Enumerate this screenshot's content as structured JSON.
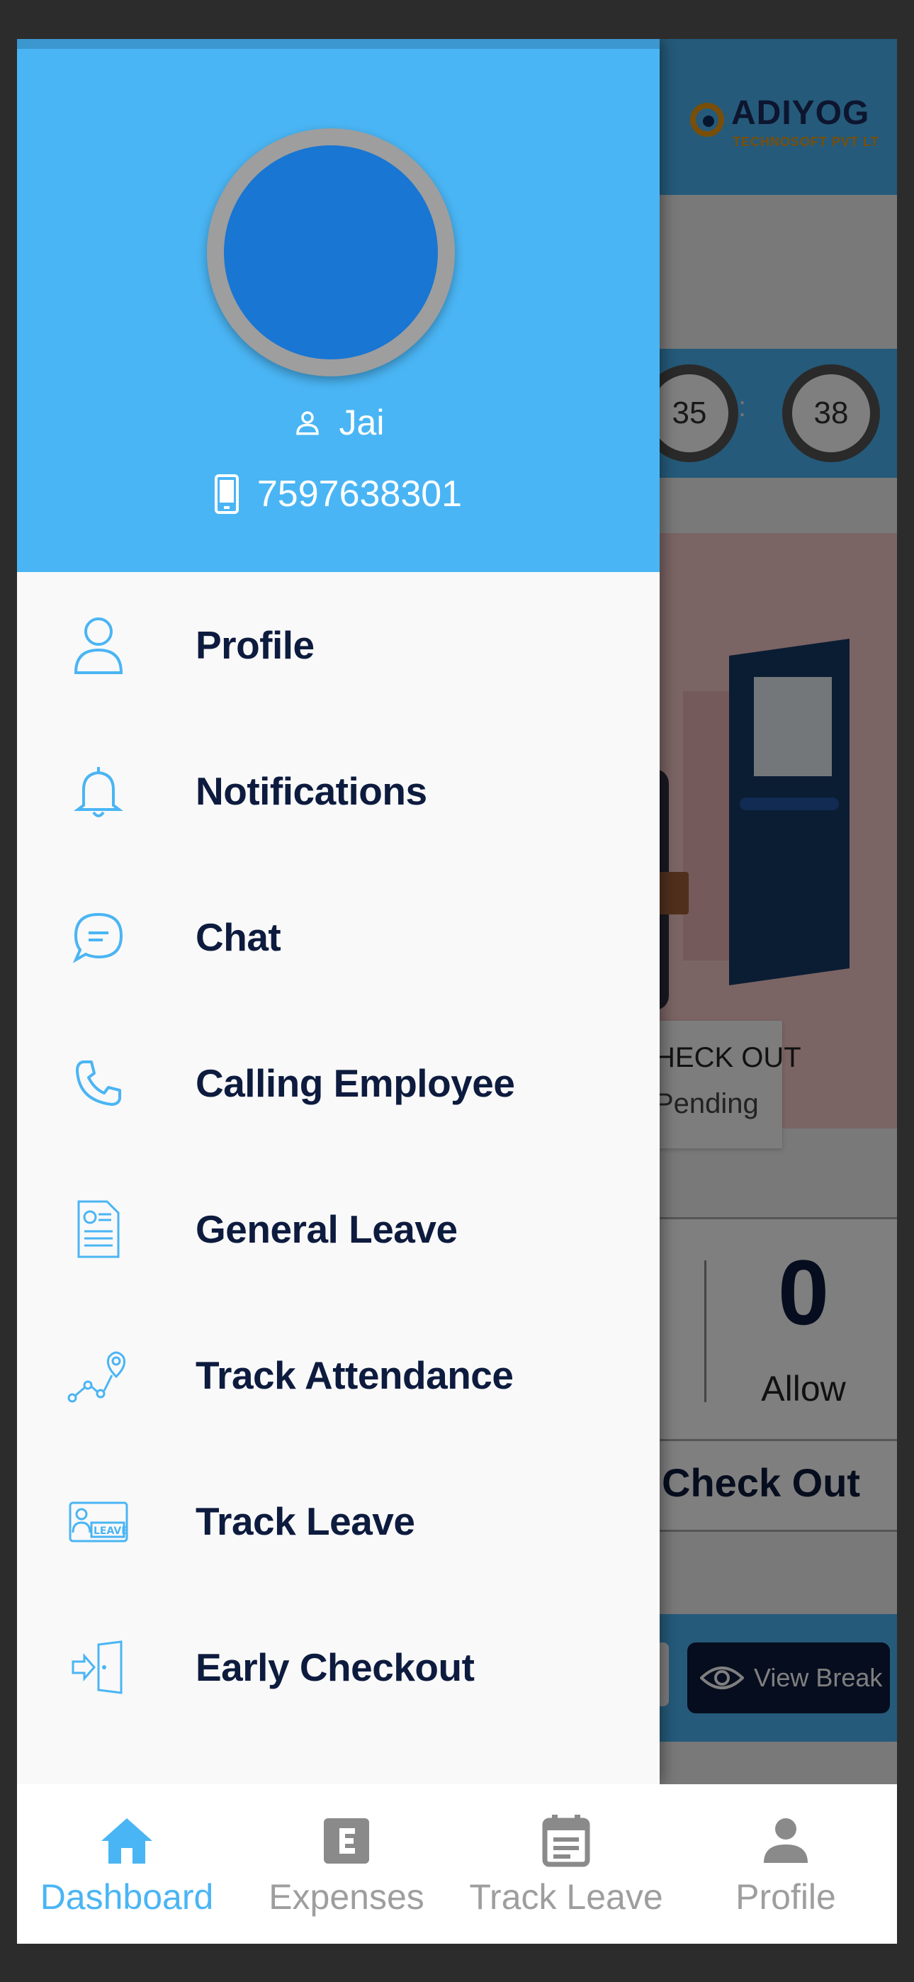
{
  "colors": {
    "primary": "#4ab5f4",
    "navy": "#0d1b3e",
    "avatar_ring": "#9e9e9e",
    "avatar_fill": "#1976d2",
    "inactive": "#9e9e9e"
  },
  "background": {
    "logo": {
      "text": "ADIYOG",
      "subtext": "TECHNOSOFT PVT LT"
    },
    "timer": {
      "minutes": "35",
      "seconds": "38",
      "separator": ":"
    },
    "checkout_card": {
      "title": "HECK OUT",
      "status": "Pending"
    },
    "stats": {
      "value": "0",
      "label": "Allow"
    },
    "check_out_button": "Check Out",
    "view_break_button": "View Break"
  },
  "drawer": {
    "user": {
      "name": "Jai",
      "phone": "7597638301"
    },
    "menu": [
      {
        "label": "Profile",
        "icon": "user-icon"
      },
      {
        "label": "Notifications",
        "icon": "bell-icon"
      },
      {
        "label": "Chat",
        "icon": "chat-icon"
      },
      {
        "label": "Calling Employee",
        "icon": "phone-icon"
      },
      {
        "label": "General Leave",
        "icon": "document-icon"
      },
      {
        "label": "Track Attendance",
        "icon": "route-pin-icon"
      },
      {
        "label": "Track Leave",
        "icon": "leave-card-icon"
      },
      {
        "label": "Early Checkout",
        "icon": "door-exit-icon"
      }
    ]
  },
  "bottom_nav": [
    {
      "label": "Dashboard",
      "icon": "home-icon",
      "active": true
    },
    {
      "label": "Expenses",
      "icon": "expenses-icon",
      "active": false
    },
    {
      "label": "Track Leave",
      "icon": "calendar-icon",
      "active": false
    },
    {
      "label": "Profile",
      "icon": "person-icon",
      "active": false
    }
  ]
}
